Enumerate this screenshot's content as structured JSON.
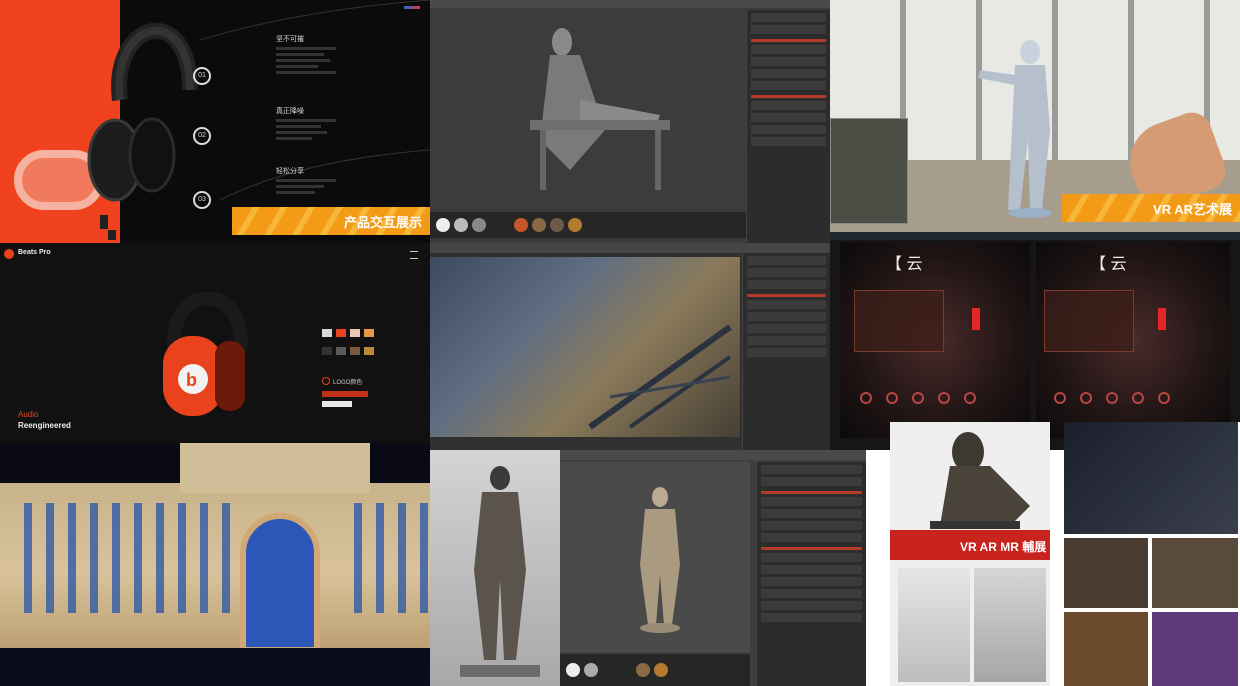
{
  "panels": {
    "product_interaction": {
      "banner": "产品交互展示",
      "steps": [
        {
          "num": "01",
          "title": "坚不可摧"
        },
        {
          "num": "02",
          "title": "真正降噪"
        },
        {
          "num": "03",
          "title": "轻松分享"
        }
      ]
    },
    "beats_pro": {
      "brand": "Beats Pro",
      "tagline_line1": "Audio",
      "tagline_line2": "Reengineered",
      "logo_label": "LOGO颜色"
    },
    "vr_ar": {
      "banner": "VR  AR艺术展"
    },
    "vr_headset_view": {
      "bracket_left": "【 云",
      "bracket_right": "【 云"
    },
    "exhibition_poster": {
      "title": "VR AR MR 輔展"
    }
  },
  "colors": {
    "orange_brand": "#f0421f",
    "banner_orange": "#f39a16",
    "beats_red": "#e8431c",
    "poster_red": "#c8231c"
  }
}
